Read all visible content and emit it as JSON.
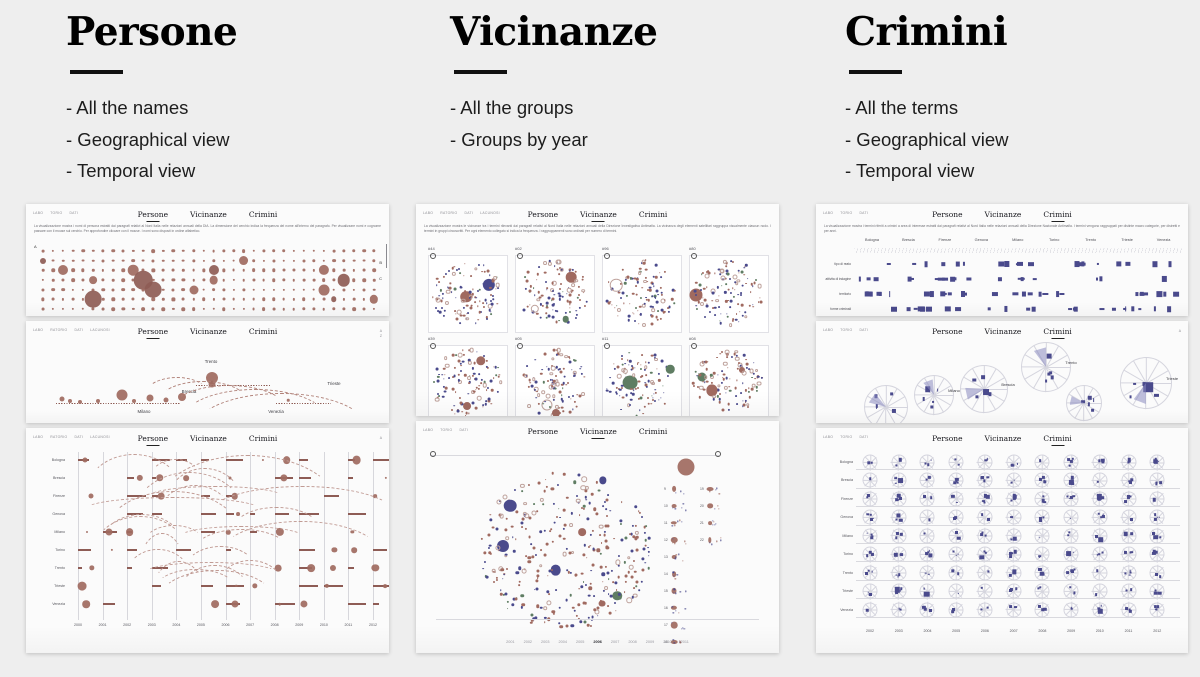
{
  "page": {
    "background": "#eeeeee",
    "accent_red": "#a06a60",
    "accent_blue": "#4a4a8c"
  },
  "columns": [
    {
      "id": "persone",
      "title": "Persone",
      "bullets": [
        "- All the names",
        "- Geographical view",
        "- Temporal view"
      ]
    },
    {
      "id": "vicinanze",
      "title": "Vicinanze",
      "bullets": [
        "- All the groups",
        "- Groups by year"
      ]
    },
    {
      "id": "crimini",
      "title": "Crimini",
      "bullets": [
        "- All the terms",
        "- Geographical view",
        "- Temporal view"
      ]
    }
  ],
  "app": {
    "nav": [
      "Persone",
      "Vicinanze",
      "Crimini"
    ],
    "brand_items": [
      "LABO",
      "TORIO",
      "DATI"
    ],
    "brand_items_long": [
      "LABO",
      "RATORIO",
      "DATI",
      "LACUNOSI"
    ],
    "corner_legend": [
      "A",
      "Z"
    ],
    "blurb_persone": "La visualizzazione mostra i nomi di persona estratti dai paragrafi relativi al Nord Italia nelle relazioni annuali della DIA. La dimensione del cerchio indica la frequenza del nome all'interno del paragrafo. Per visualizzare nomi e cognome passare con il mouse sul cerchio. Per approfondire cliccare con il mouse. I nomi sono disposti in ordine alfabetico.",
    "blurb_vicinanze": "La visualizzazione mostra le vicinanze tra i termini rilevanti dai paragrafi relativi al Nord Italia nelle relazioni annuali della Direzione Investigativa Antimafia. La vicinanza degli elementi satellitari raggruppa visualmente ciascun nodo. I termini in gruppi circoscritti. Per ogni elemento collegato si indica la frequenza. I raggruppamenti sono ordinati per numero di termini.",
    "blurb_crimini": "La visualizzazione mostra i termini riferiti a crimini a area di interesse estratti dai paragrafi relativi al Nord Italia nelle relazioni annuali della Direzione Nazionale Antimafia. I termini vengono raggruppati per distinte macro categorie, per distretti e per anni.",
    "cities": [
      "Bologna",
      "Brescia",
      "Firenze",
      "Genova",
      "Milano",
      "Torino",
      "Trento",
      "Trieste",
      "Venezia"
    ],
    "geo_cities": [
      "Trento",
      "Brescia",
      "Milano",
      "Venezia",
      "Trieste"
    ],
    "geo_cities_crimini": [
      "Milano",
      "Brescia",
      "Trento",
      "Trieste"
    ],
    "years": [
      "2000",
      "2001",
      "2002",
      "2003",
      "2004",
      "2005",
      "2006",
      "2007",
      "2008",
      "2009",
      "2010",
      "2011",
      "2012"
    ],
    "years_crimini": [
      "2002",
      "2003",
      "2004",
      "2005",
      "2006",
      "2007",
      "2008",
      "2009",
      "2010",
      "2011",
      "2012"
    ],
    "year_strip": [
      "2001",
      "2002",
      "2003",
      "2004",
      "2005",
      "2006",
      "2007",
      "2008",
      "2009",
      "2010",
      "2011"
    ],
    "year_strip_selected": "2006",
    "matrix_categories": [
      "tipo di\\nreato",
      "attivita\\ndi indagine",
      "territorio",
      "forme\\ncriminali"
    ],
    "cluster_ids": [
      "#44",
      "#02",
      "#96",
      "#80",
      "#39",
      "#05",
      "#11",
      "#08"
    ],
    "legend_numbers": [
      "9",
      "10",
      "11",
      "12",
      "13",
      "14",
      "15",
      "16",
      "17",
      "18",
      "19",
      "20",
      "21",
      "22"
    ]
  },
  "chart_data": [
    {
      "type": "scatter",
      "title": "Persone — All the names",
      "note": "Alphabetical grid of name circles; radius = frequency",
      "rows": 7,
      "cols": 34
    },
    {
      "type": "scatter",
      "title": "Persone — Geographical view",
      "cities": [
        "Trento",
        "Brescia",
        "Milano",
        "Venezia",
        "Trieste"
      ]
    },
    {
      "type": "scatter",
      "title": "Persone — Temporal view",
      "categories": [
        "Bologna",
        "Brescia",
        "Firenze",
        "Genova",
        "Milano",
        "Torino",
        "Trento",
        "Trieste",
        "Venezia"
      ],
      "x": [
        "2000",
        "2001",
        "2002",
        "2003",
        "2004",
        "2005",
        "2006",
        "2007",
        "2008",
        "2009",
        "2010",
        "2011",
        "2012"
      ]
    },
    {
      "type": "scatter",
      "title": "Vicinanze — All the groups",
      "note": "Eight force-directed cluster cells"
    },
    {
      "type": "scatter",
      "title": "Vicinanze — Groups by year",
      "x": [
        "2001",
        "2002",
        "2003",
        "2004",
        "2005",
        "2006",
        "2007",
        "2008",
        "2009",
        "2010",
        "2011"
      ],
      "selected": "2006"
    },
    {
      "type": "heatmap",
      "title": "Crimini — All the terms",
      "categories": [
        "Bologna",
        "Brescia",
        "Firenze",
        "Genova",
        "Milano",
        "Torino",
        "Trento",
        "Trieste",
        "Venezia"
      ],
      "rows": [
        "tipo di reato",
        "attivita di indagine",
        "territorio",
        "forme criminali"
      ]
    },
    {
      "type": "scatter",
      "title": "Crimini — Geographical view",
      "cities": [
        "Milano",
        "Brescia",
        "Trento",
        "Trieste"
      ]
    },
    {
      "type": "heatmap",
      "title": "Crimini — Temporal view",
      "categories": [
        "Bologna",
        "Brescia",
        "Firenze",
        "Genova",
        "Milano",
        "Torino",
        "Trento",
        "Trieste",
        "Venezia"
      ],
      "x": [
        "2002",
        "2003",
        "2004",
        "2005",
        "2006",
        "2007",
        "2008",
        "2009",
        "2010",
        "2011",
        "2012"
      ]
    }
  ]
}
